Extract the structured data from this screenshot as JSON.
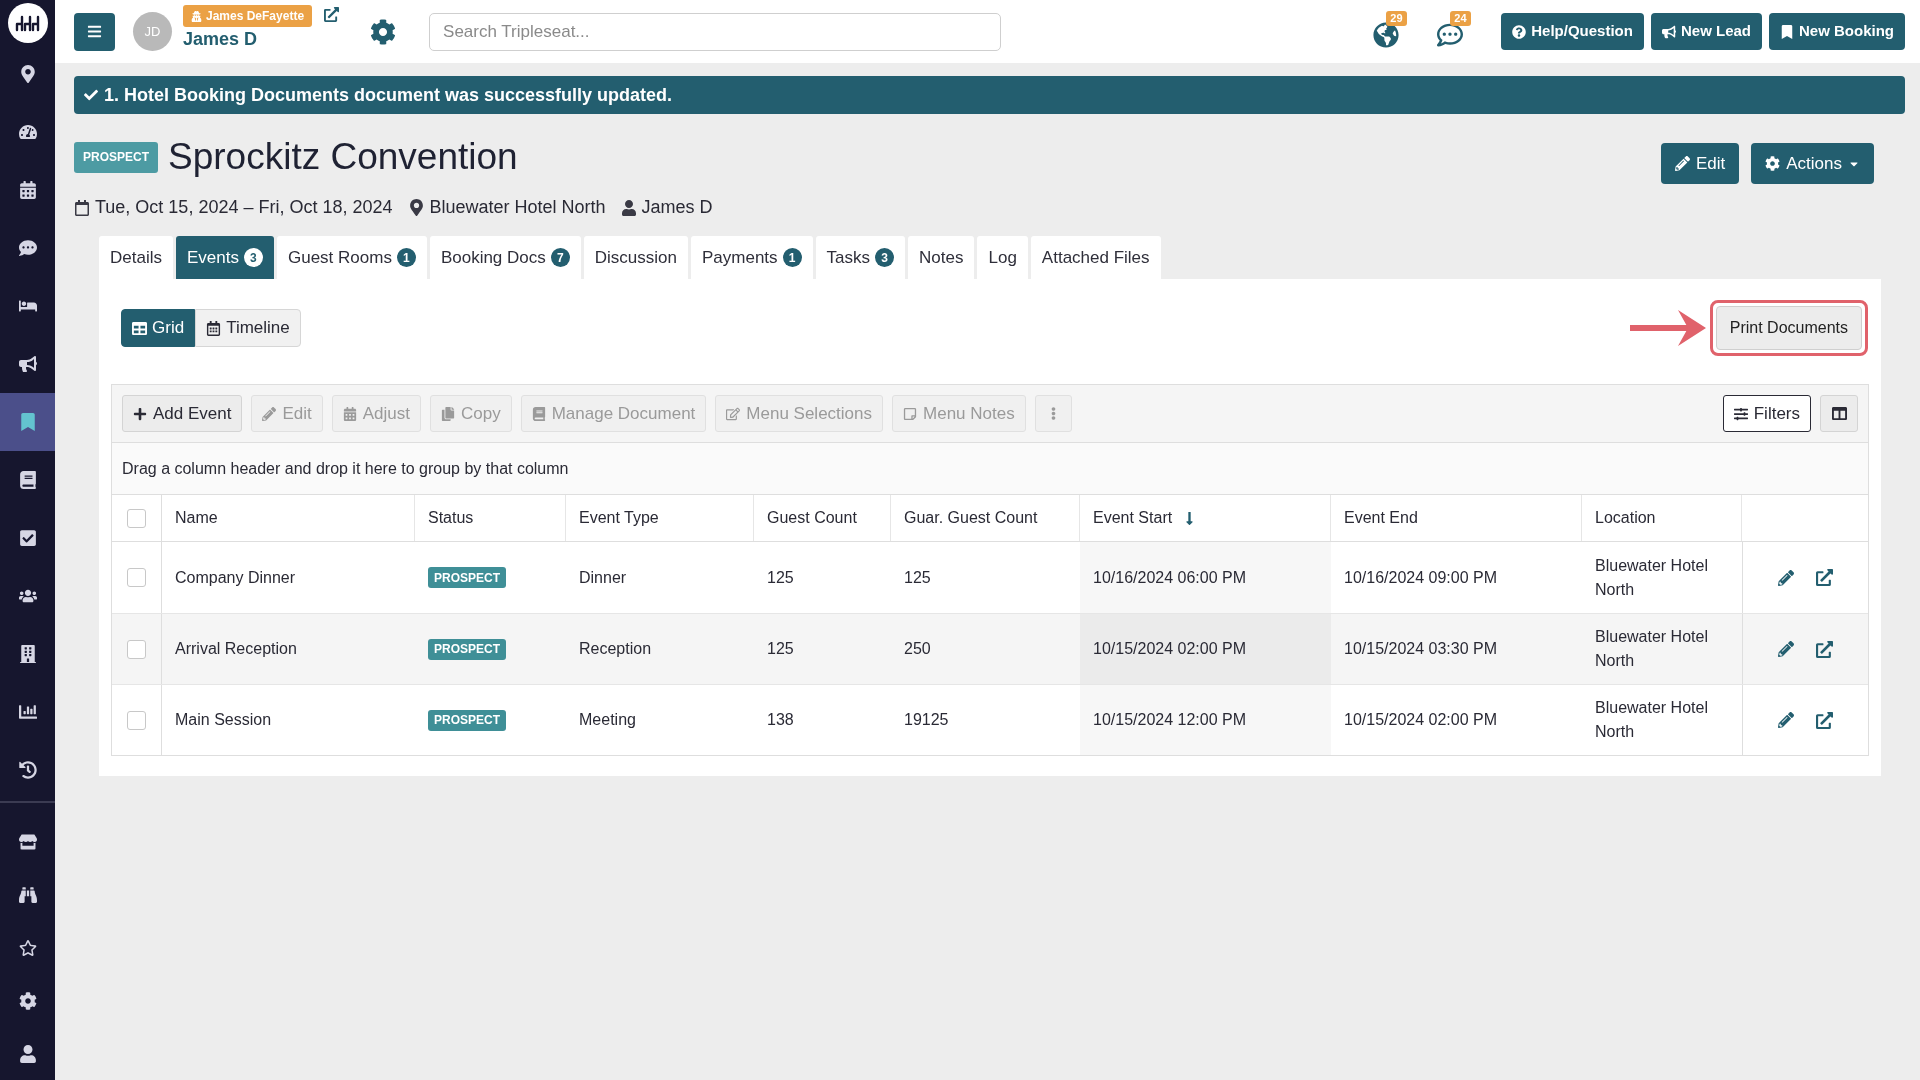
{
  "sidebar": {
    "main_items": [
      {
        "selected": false
      },
      {
        "selected": false
      },
      {
        "selected": false
      },
      {
        "selected": false
      },
      {
        "selected": false
      },
      {
        "selected": false
      },
      {
        "selected": true
      },
      {
        "selected": false
      },
      {
        "selected": false
      },
      {
        "selected": false
      },
      {
        "selected": false
      },
      {
        "selected": false
      },
      {
        "selected": false
      }
    ],
    "bottom_items": [
      {
        "selected": false
      },
      {
        "selected": false
      },
      {
        "selected": false
      },
      {
        "selected": false
      },
      {
        "selected": false
      }
    ]
  },
  "top_bar": {
    "user": {
      "initials": "JD",
      "impersonating": "James DeFayette",
      "name": "James D"
    },
    "search": {
      "placeholder": "Search Tripleseat..."
    },
    "notifications": [
      {
        "count": "29"
      },
      {
        "count": "24"
      }
    ],
    "buttons": [
      "Help/Question",
      "New Lead",
      "New Booking"
    ]
  },
  "alert": {
    "message": "1. Hotel Booking Documents document was successfully updated."
  },
  "header": {
    "status": "PROSPECT",
    "title": "Sprockitz Convention",
    "date_range": "Tue, Oct 15, 2024 – Fri, Oct 18, 2024",
    "location": "Bluewater Hotel North",
    "owner": "James D",
    "buttons": [
      "Edit",
      "Actions"
    ]
  },
  "tabs": [
    {
      "label": "Details",
      "selected": false
    },
    {
      "label": "Events",
      "count": "3",
      "selected": true
    },
    {
      "label": "Guest Rooms",
      "count": "1",
      "selected": false
    },
    {
      "label": "Booking Docs",
      "count": "7",
      "selected": false
    },
    {
      "label": "Discussion",
      "selected": false
    },
    {
      "label": "Payments",
      "count": "1",
      "selected": false
    },
    {
      "label": "Tasks",
      "count": "3",
      "selected": false
    },
    {
      "label": "Notes",
      "selected": false
    },
    {
      "label": "Log",
      "selected": false
    },
    {
      "label": "Attached Files",
      "selected": false
    }
  ],
  "view_toggle": [
    {
      "label": "Grid",
      "selected": true
    },
    {
      "label": "Timeline",
      "selected": false
    }
  ],
  "print_button": {
    "label": "Print Documents",
    "highlighted": true
  },
  "toolbar": {
    "buttons": [
      {
        "label": "Add Event",
        "disabled": false
      },
      {
        "label": "Edit",
        "disabled": true
      },
      {
        "label": "Adjust",
        "disabled": true
      },
      {
        "label": "Copy",
        "disabled": true
      },
      {
        "label": "Manage Document",
        "disabled": true
      },
      {
        "label": "Menu Selections",
        "disabled": true
      },
      {
        "label": "Menu Notes",
        "disabled": true
      }
    ],
    "filters": "Filters"
  },
  "group_hint": "Drag a column header and drop it here to group by that column",
  "table": {
    "all_checked": false,
    "columns": [
      {
        "label": "Name",
        "sorted": false
      },
      {
        "label": "Status",
        "sorted": false
      },
      {
        "label": "Event Type",
        "sorted": false
      },
      {
        "label": "Guest Count",
        "sorted": false
      },
      {
        "label": "Guar. Guest Count",
        "sorted": false
      },
      {
        "label": "Event Start",
        "sorted": true
      },
      {
        "label": "Event End",
        "sorted": false
      },
      {
        "label": "Location",
        "sorted": false
      }
    ],
    "rows": [
      {
        "checked": false,
        "name": "Company Dinner",
        "status": "PROSPECT",
        "event_type": "Dinner",
        "guest_count": "125",
        "guar_guest_count": "125",
        "event_start": "10/16/2024 06:00 PM",
        "event_end": "10/16/2024 09:00 PM",
        "location": "Bluewater Hotel North"
      },
      {
        "checked": false,
        "name": "Arrival Reception",
        "status": "PROSPECT",
        "event_type": "Reception",
        "guest_count": "125",
        "guar_guest_count": "250",
        "event_start": "10/15/2024 02:00 PM",
        "event_end": "10/15/2024 03:30 PM",
        "location": "Bluewater Hotel North"
      },
      {
        "checked": false,
        "name": "Main Session",
        "status": "PROSPECT",
        "event_type": "Meeting",
        "guest_count": "138",
        "guar_guest_count": "19125",
        "event_start": "10/15/2024 12:00 PM",
        "event_end": "10/15/2024 02:00 PM",
        "location": "Bluewater Hotel North"
      }
    ]
  }
}
